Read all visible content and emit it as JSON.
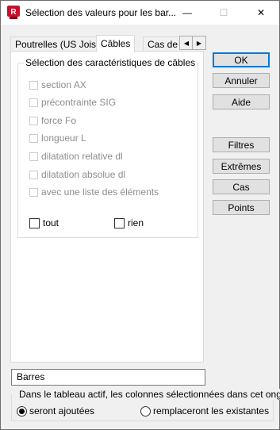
{
  "window": {
    "title": "Sélection des valeurs pour les bar...",
    "app_icon": "robot-app-icon",
    "minimize": "—",
    "maximize": "☐",
    "close": "✕"
  },
  "tabs": [
    {
      "label": "Poutrelles (US Joist)",
      "active": false
    },
    {
      "label": "Câbles",
      "active": true
    },
    {
      "label": "Cas de cha",
      "active": false
    }
  ],
  "tab_scroll": {
    "left": "◀",
    "right": "▶"
  },
  "group": {
    "title": "Sélection des caractéristiques de câbles",
    "items": [
      {
        "label": "section AX",
        "checked": false,
        "enabled": false
      },
      {
        "label": "précontrainte SIG",
        "checked": false,
        "enabled": false
      },
      {
        "label": "force Fo",
        "checked": false,
        "enabled": false
      },
      {
        "label": "longueur L",
        "checked": false,
        "enabled": false
      },
      {
        "label": "dilatation relative dl",
        "checked": false,
        "enabled": false
      },
      {
        "label": "dilatation absolue dl",
        "checked": false,
        "enabled": false
      },
      {
        "label": "avec une liste des éléments",
        "checked": false,
        "enabled": false
      }
    ],
    "all_label": "tout",
    "none_label": "rien"
  },
  "buttons": {
    "ok": "OK",
    "cancel": "Annuler",
    "help": "Aide",
    "filters": "Filtres",
    "extremes": "Extrêmes",
    "cases": "Cas",
    "points": "Points"
  },
  "target_field": {
    "value": "Barres"
  },
  "columns_option": {
    "title": "Dans le tableau actif, les colonnes sélectionnées dans cet onglet",
    "option_add": "seront ajoutées",
    "option_replace": "remplaceront les existantes",
    "selected": "add"
  },
  "colors": {
    "accent": "#0078d7",
    "app_icon_red": "#c8102e"
  }
}
